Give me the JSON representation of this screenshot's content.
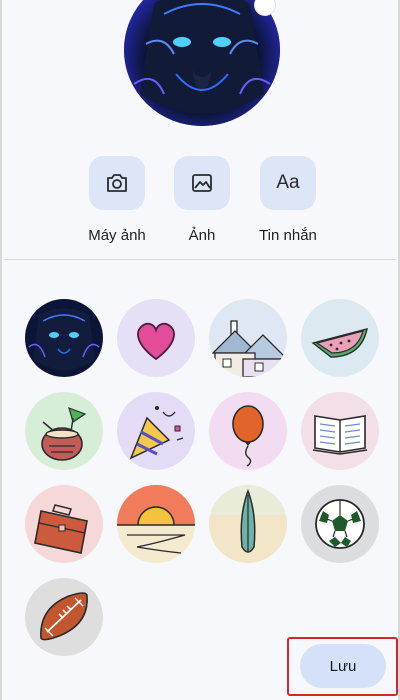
{
  "options": {
    "camera_label": "Máy ảnh",
    "photo_label": "Ảnh",
    "text_label": "Tin nhắn",
    "text_icon_glyph": "Aa"
  },
  "avatar_grid": [
    {
      "name": "panther-photo",
      "bg": "#0b1538"
    },
    {
      "name": "heart",
      "bg": "#e6e0f6"
    },
    {
      "name": "houses",
      "bg": "#dfe6f4"
    },
    {
      "name": "watermelon",
      "bg": "#dde9f1"
    },
    {
      "name": "coconut-drink",
      "bg": "#d6eed8"
    },
    {
      "name": "party-popper",
      "bg": "#e4dcf6"
    },
    {
      "name": "balloon",
      "bg": "#f1dcf2"
    },
    {
      "name": "open-book",
      "bg": "#f3dfe8"
    },
    {
      "name": "briefcase",
      "bg": "#f6d8d8"
    },
    {
      "name": "sunset",
      "bg": "#f0f0dc"
    },
    {
      "name": "surfboard",
      "bg": "#f4ecd7"
    },
    {
      "name": "soccer-ball",
      "bg": "#dcdde0"
    },
    {
      "name": "football",
      "bg": "#dedede"
    }
  ],
  "actions": {
    "save_label": "Lưu"
  },
  "colors": {
    "accent_button": "#d4e1f8",
    "option_tile": "#dde6f7",
    "highlight_border": "#d9262b"
  }
}
